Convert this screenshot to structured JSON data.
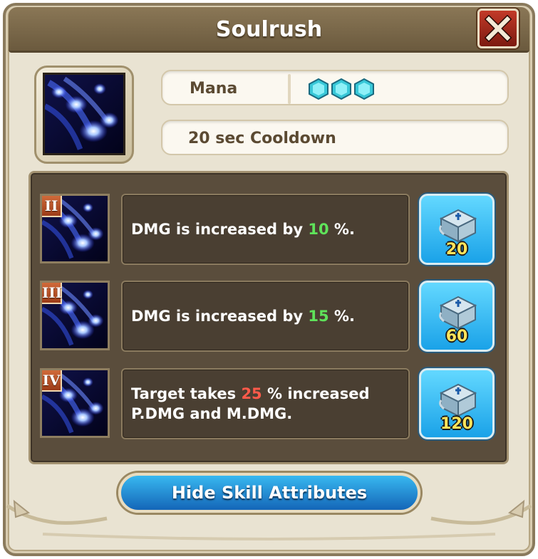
{
  "dialog": {
    "title": "Soulrush",
    "close_label": "X"
  },
  "skill": {
    "resource_label": "Mana",
    "mana_gems": 3,
    "cooldown_text": "20 sec Cooldown"
  },
  "attributes": [
    {
      "rank": "II",
      "text_before": "DMG is increased by ",
      "value": "10",
      "text_after": " %.",
      "line2": "",
      "value_color": "green",
      "cost": "20"
    },
    {
      "rank": "III",
      "text_before": "DMG is increased by ",
      "value": "15",
      "text_after": " %.",
      "line2": "",
      "value_color": "green",
      "cost": "60"
    },
    {
      "rank": "IV",
      "text_before": "Target takes ",
      "value": "25",
      "text_after": " % increased",
      "line2": "P.DMG and M.DMG.",
      "value_color": "red",
      "cost": "120"
    }
  ],
  "footer": {
    "hide_button_label": "Hide Skill Attributes"
  },
  "colors": {
    "accent_green": "#5fe35a",
    "accent_red": "#ff5a4a",
    "cost_yellow": "#ffe45a",
    "button_blue": "#1aa2e8"
  }
}
